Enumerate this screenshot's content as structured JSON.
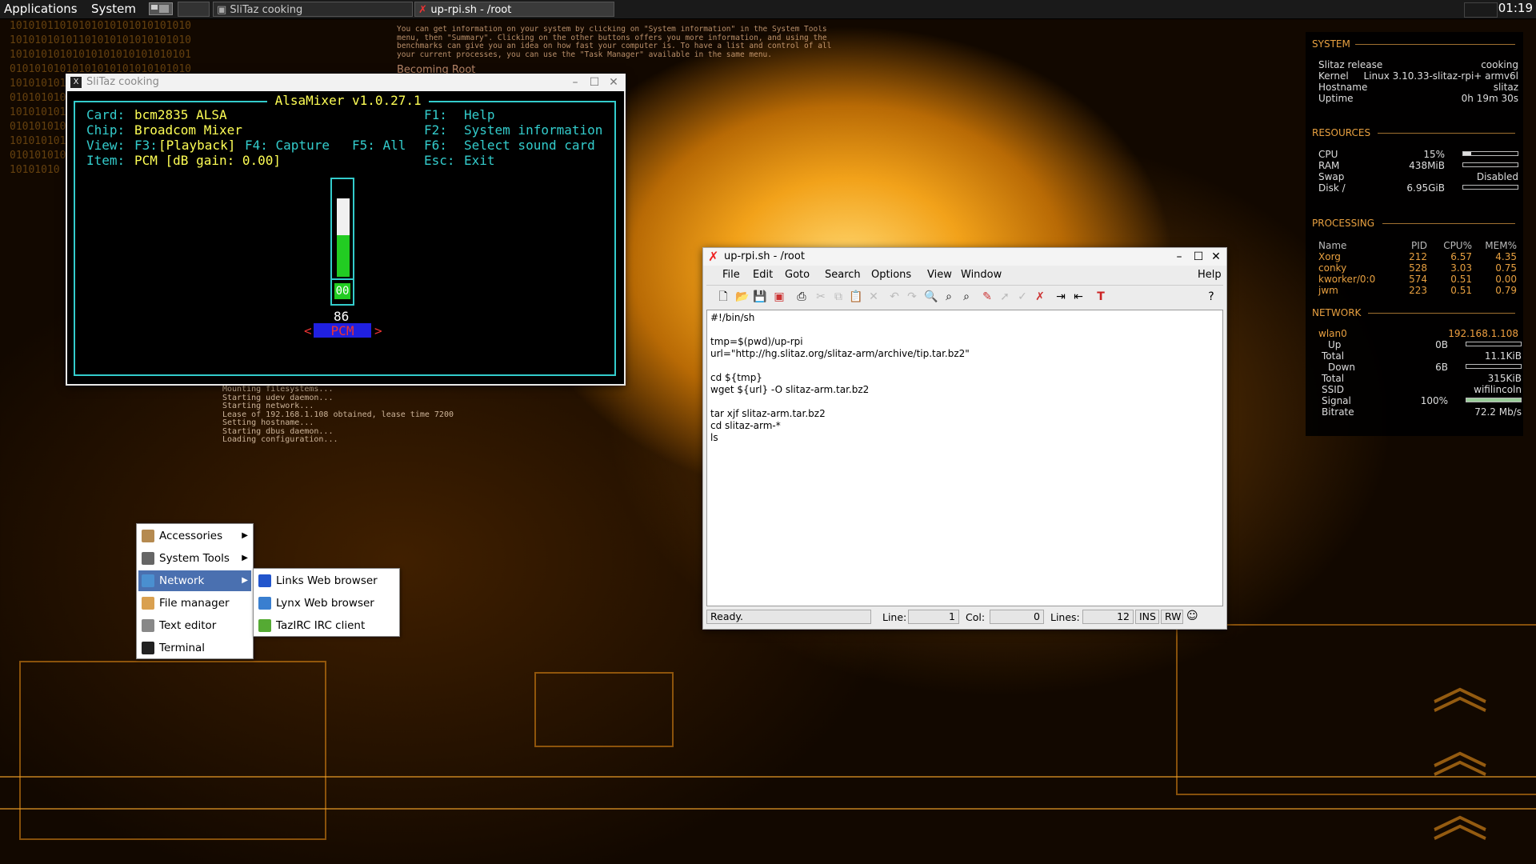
{
  "panel": {
    "applications": "Applications",
    "system": "System",
    "tasks": [
      {
        "label": "SliTaz cooking",
        "active": false
      },
      {
        "label": "up-rpi.sh - /root",
        "active": true
      }
    ],
    "clock": "01:19"
  },
  "wallpaper": {
    "binary": "1010101101010101010101010101010101010101101010101010101010101010101010101010101010101010101010101010101010101010101010101010101010101010101010101010101010101010101010101010101010101010101010101010101010101010101010101010101010101010101010101010101010101010101010101010101010101010101010101010101010",
    "top_text": "You can get information on your system by clicking on \"System information\" in the System Tools\nmenu, then \"Summary\". Clicking on the other buttons offers you more information, and using the\nbenchmarks can give you an idea on how fast your computer is. To have a list and control of all\nyour current processes, you can use the \"Task Manager\" available in the same menu.",
    "heading": "Becoming Root",
    "boot_log": "Mounting filesystems...\nStarting udev daemon...\nStarting network...\nLease of 192.168.1.108 obtained, lease time 7200\nSetting hostname...\nStarting dbus daemon...\nLoading configuration..."
  },
  "conky": {
    "system_title": "SYSTEM",
    "system": [
      {
        "label": "Slitaz release",
        "value": "cooking"
      },
      {
        "label": "Kernel",
        "value": "Linux 3.10.33-slitaz-rpi+ armv6l"
      },
      {
        "label": "Hostname",
        "value": "slitaz"
      },
      {
        "label": "Uptime",
        "value": "0h 19m 30s"
      }
    ],
    "resources_title": "RESOURCES",
    "resources": [
      {
        "label": "CPU",
        "value": "15%",
        "bar": 0.15
      },
      {
        "label": "RAM",
        "value": "438MiB",
        "bar": 0.0
      },
      {
        "label": "Swap",
        "value": "Disabled"
      },
      {
        "label": "Disk /",
        "value": "6.95GiB",
        "bar": 0.0
      }
    ],
    "processing_title": "PROCESSING",
    "proc_headers": [
      "Name",
      "PID",
      "CPU%",
      "MEM%"
    ],
    "processes": [
      {
        "name": "Xorg",
        "pid": "212",
        "cpu": "6.57",
        "mem": "4.35"
      },
      {
        "name": "conky",
        "pid": "528",
        "cpu": "3.03",
        "mem": "0.75"
      },
      {
        "name": "kworker/0:0",
        "pid": "574",
        "cpu": "0.51",
        "mem": "0.00"
      },
      {
        "name": "jwm",
        "pid": "223",
        "cpu": "0.51",
        "mem": "0.79"
      }
    ],
    "network_title": "NETWORK",
    "iface": "wlan0",
    "ip": "192.168.1.108",
    "net": [
      {
        "label": "Up",
        "value": "0B"
      },
      {
        "label": "Total",
        "value": "11.1KiB"
      },
      {
        "label": "Down",
        "value": "6B"
      },
      {
        "label": "Total",
        "value": "315KiB"
      },
      {
        "label": "SSID",
        "value": "wifilincoln"
      },
      {
        "label": "Signal",
        "value": "100%",
        "bar": 1.0
      },
      {
        "label": "Bitrate",
        "value": "72.2 Mb/s"
      }
    ],
    "accent": "#e8a040",
    "ip_color": "#f0a040"
  },
  "alsamixer": {
    "window_title": "SliTaz cooking",
    "title": " AlsaMixer v1.0.27.1 ",
    "card_label": "Card:",
    "card": "bcm2835 ALSA",
    "chip_label": "Chip:",
    "chip": "Broadcom Mixer",
    "view_label": "View:",
    "view_f3": "F3:",
    "view_playback": "[Playback]",
    "view_f4": "F4: Capture",
    "view_f5": "F5: All",
    "item_label": "Item:",
    "item": "PCM [dB gain: 0.00]",
    "help": [
      {
        "key": "F1:",
        "text": "Help"
      },
      {
        "key": "F2:",
        "text": "System information"
      },
      {
        "key": "F6:",
        "text": "Select sound card"
      },
      {
        "key": "Esc:",
        "text": "Exit"
      }
    ],
    "volume_fraction": 0.86,
    "mute": "00",
    "level": "86",
    "channel": "PCM",
    "lt": "<",
    "gt": ">"
  },
  "leafpad": {
    "title": "up-rpi.sh - /root",
    "menu": [
      "File",
      "Edit",
      "Goto",
      "Search",
      "Options",
      "View",
      "Window"
    ],
    "help": "Help",
    "code": [
      "#!/bin/sh",
      "",
      "tmp=$(pwd)/up-rpi",
      "url=\"http://hg.slitaz.org/slitaz-arm/archive/tip.tar.bz2\"",
      "",
      "cd ${tmp}",
      "wget ${url} -O slitaz-arm.tar.bz2",
      "",
      "tar xjf slitaz-arm.tar.bz2",
      "cd slitaz-arm-*",
      "ls"
    ],
    "status": "Ready.",
    "line_label": "Line:",
    "line": "1",
    "col_label": "Col:",
    "col": "0",
    "lines_label": "Lines:",
    "lines": "12",
    "ins": "INS",
    "rw": "RW"
  },
  "start_menu": {
    "items": [
      {
        "label": "Accessories",
        "icon": "accessories-icon",
        "submenu": true
      },
      {
        "label": "System Tools",
        "icon": "system-tools-icon",
        "submenu": true
      },
      {
        "label": "Network",
        "icon": "network-icon",
        "submenu": true,
        "selected": true
      },
      {
        "label": "File manager",
        "icon": "folder-icon"
      },
      {
        "label": "Text editor",
        "icon": "text-editor-icon"
      },
      {
        "label": "Terminal",
        "icon": "terminal-icon"
      }
    ],
    "network_items": [
      {
        "label": "Links Web browser",
        "icon": "links-icon"
      },
      {
        "label": "Lynx Web browser",
        "icon": "lynx-icon"
      },
      {
        "label": "TazIRC IRC client",
        "icon": "irc-icon"
      }
    ]
  }
}
